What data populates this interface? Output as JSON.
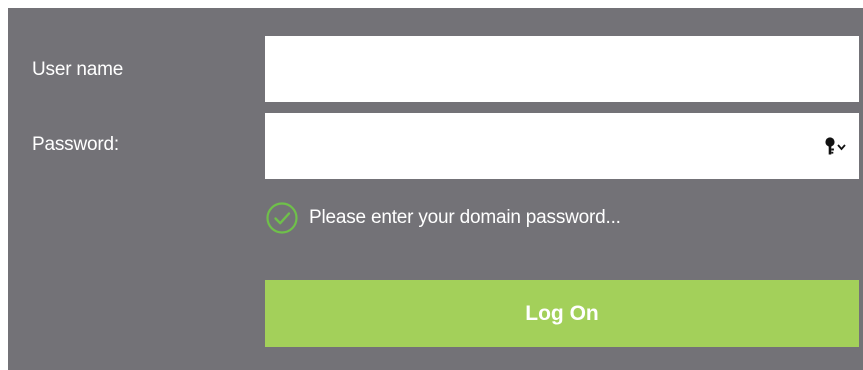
{
  "form": {
    "username_label": "User name",
    "username_value": "",
    "password_label": "Password:",
    "password_value": "",
    "password_toggle_icon": "key-dropdown-icon",
    "hint_icon": "check-circle-icon",
    "hint_text": "Please enter your domain password...",
    "submit_label": "Log On"
  },
  "colors": {
    "panel_background": "#737277",
    "field_background": "#ffffff",
    "accent_green": "#a3d05a",
    "hint_icon": "#6fc04a",
    "text": "#ffffff"
  }
}
